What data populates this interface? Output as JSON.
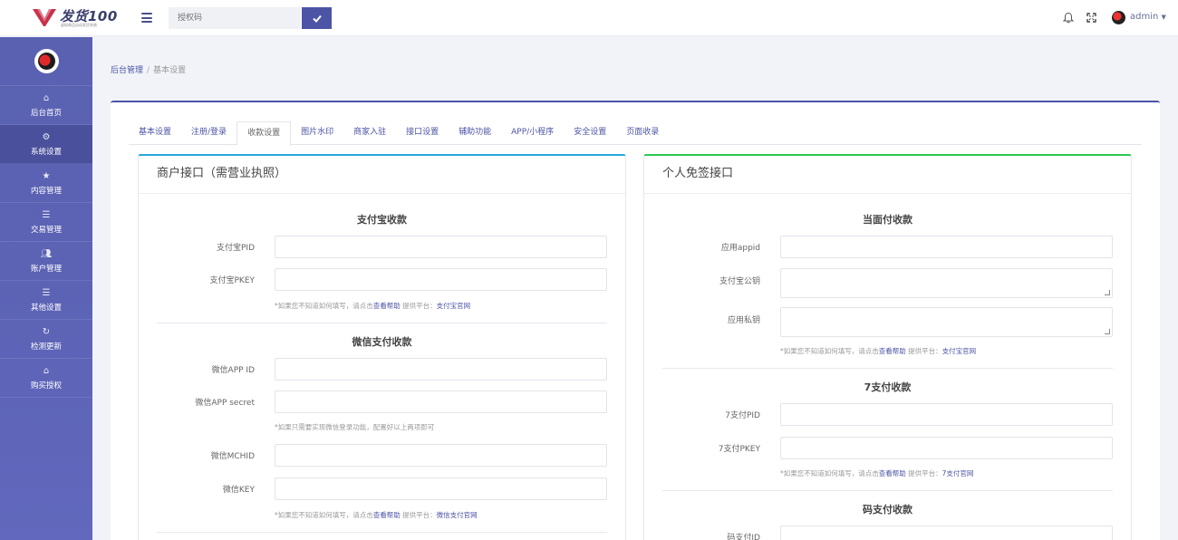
{
  "brand": {
    "name": "发货100",
    "subtitle": "虚拟商品自动发货系统",
    "color": "#3a3f6c"
  },
  "header": {
    "search_placeholder": "授权码",
    "search_icon": "check-icon",
    "icons": [
      "bell-icon",
      "fullscreen-icon"
    ],
    "user": "admin"
  },
  "sidebar": {
    "items": [
      {
        "icon": "home-icon",
        "label": "后台首页"
      },
      {
        "icon": "gear-icon",
        "label": "系统设置",
        "active": true
      },
      {
        "icon": "star-icon",
        "label": "内容管理"
      },
      {
        "icon": "list-icon",
        "label": "交易管理"
      },
      {
        "icon": "users-icon",
        "label": "账户管理"
      },
      {
        "icon": "list-icon",
        "label": "其他设置"
      },
      {
        "icon": "refresh-icon",
        "label": "检测更新"
      },
      {
        "icon": "home-icon",
        "label": "购买授权"
      }
    ]
  },
  "breadcrumb": {
    "home": "后台管理",
    "current": "基本设置"
  },
  "tabs": [
    "基本设置",
    "注册/登录",
    "收款设置",
    "图片水印",
    "商家入驻",
    "接口设置",
    "辅助功能",
    "APP/小程序",
    "安全设置",
    "页面收录"
  ],
  "active_tab": "收款设置",
  "left_panel": {
    "title": "商户接口（需营业执照）",
    "sections": {
      "alipay": {
        "title": "支付宝收款",
        "pid_label": "支付宝PID",
        "pkey_label": "支付宝PKEY",
        "note_prefix": "*如果您不知道如何填写，请点击",
        "note_help": "查看帮助",
        "note_platform": "提供平台：",
        "note_link": "支付宝官网"
      },
      "wechat": {
        "title": "微信支付收款",
        "appid_label": "微信APP ID",
        "secret_label": "微信APP secret",
        "login_note": "*如果只需要实现微信登录功能，配置好以上两项即可",
        "mchid_label": "微信MCHID",
        "key_label": "微信KEY",
        "note_prefix": "*如果您不知道如何填写，请点击",
        "note_help": "查看帮助",
        "note_platform": "提供平台：",
        "note_link": "微信支付官网"
      }
    }
  },
  "right_panel": {
    "title": "个人免签接口",
    "sections": {
      "f2f": {
        "title": "当面付收款",
        "appid_label": "应用appid",
        "pubkey_label": "支付宝公钥",
        "privkey_label": "应用私钥",
        "note_prefix": "*如果您不知道如何填写，请点击",
        "note_help": "查看帮助",
        "note_platform": "提供平台：",
        "note_link": "支付宝官网"
      },
      "pay7": {
        "title": "7支付收款",
        "pid_label": "7支付PID",
        "pkey_label": "7支付PKEY",
        "note_prefix": "*如果您不知道如何填写，请点击",
        "note_help": "查看帮助",
        "note_platform": "提供平台：",
        "note_link": "7支付官网"
      },
      "codepay": {
        "title": "码支付收款",
        "id_label": "码支付ID"
      }
    }
  },
  "colors": {
    "primary": "#4c54a6",
    "sidebar": "#5a61b1",
    "left_accent": "#29a8e0",
    "right_accent": "#2ec653"
  }
}
